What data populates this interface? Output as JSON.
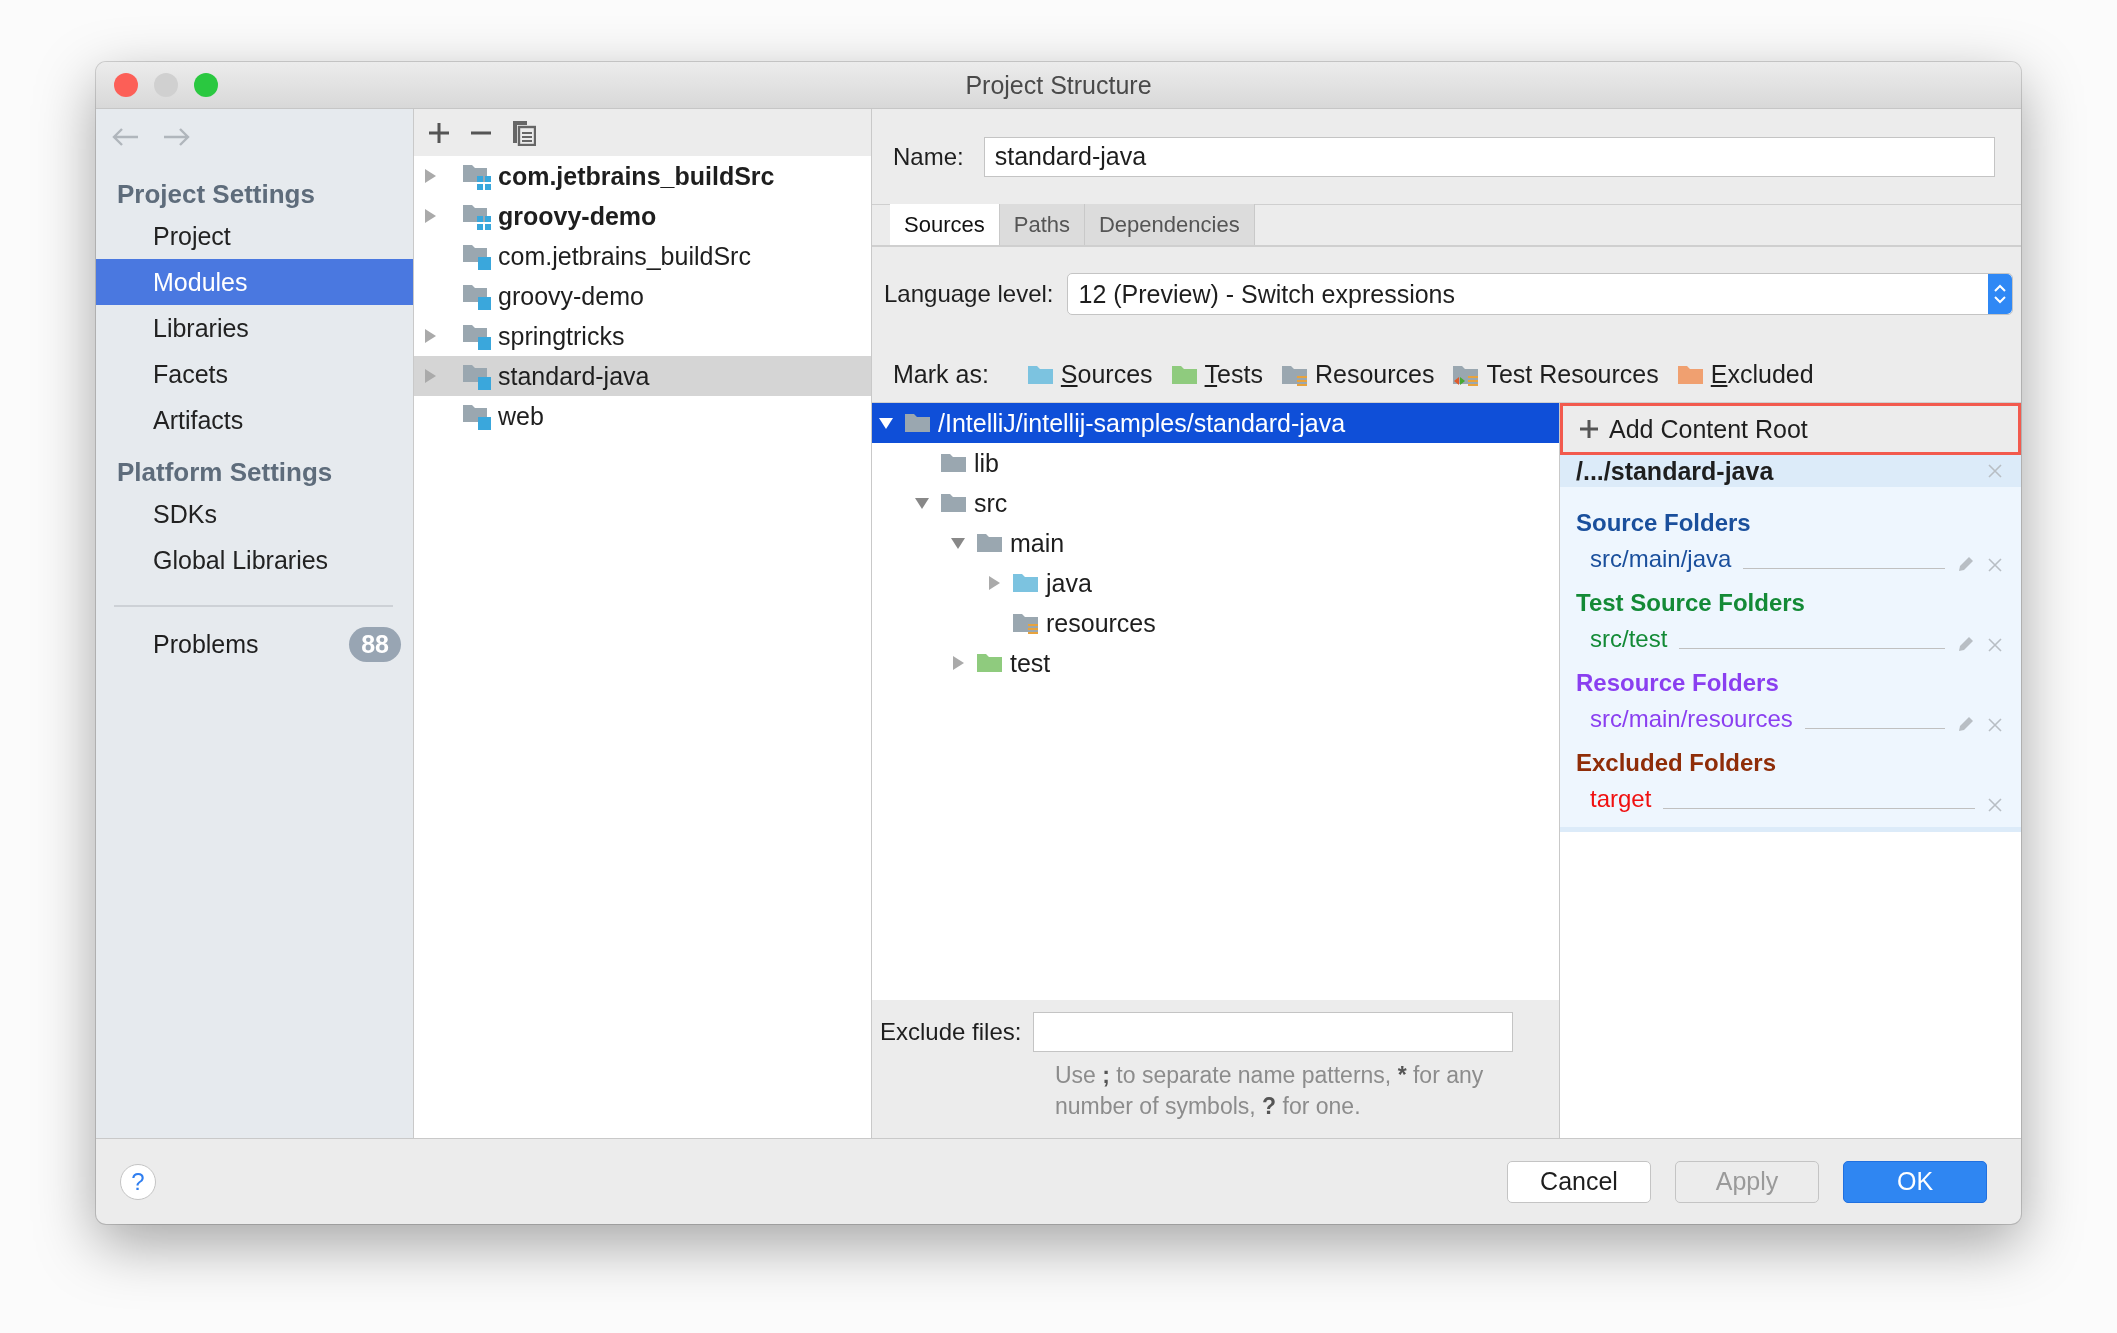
{
  "window": {
    "title": "Project Structure"
  },
  "sidebar": {
    "sections": [
      {
        "heading": "Project Settings",
        "items": [
          {
            "label": "Project",
            "selected": false
          },
          {
            "label": "Modules",
            "selected": true
          },
          {
            "label": "Libraries",
            "selected": false
          },
          {
            "label": "Facets",
            "selected": false
          },
          {
            "label": "Artifacts",
            "selected": false
          }
        ]
      },
      {
        "heading": "Platform Settings",
        "items": [
          {
            "label": "SDKs",
            "selected": false
          },
          {
            "label": "Global Libraries",
            "selected": false
          }
        ]
      }
    ],
    "problems": {
      "label": "Problems",
      "count": "88"
    }
  },
  "module_list": {
    "items": [
      {
        "label": "com.jetbrains_buildSrc",
        "kind": "group",
        "expanded": false,
        "selected": false
      },
      {
        "label": "groovy-demo",
        "kind": "group",
        "expanded": false,
        "selected": false
      },
      {
        "label": "com.jetbrains_buildSrc",
        "kind": "module",
        "selected": false
      },
      {
        "label": "groovy-demo",
        "kind": "module",
        "selected": false
      },
      {
        "label": "springtricks",
        "kind": "module",
        "expanded": false,
        "selected": false
      },
      {
        "label": "standard-java",
        "kind": "module",
        "expanded": false,
        "selected": true
      },
      {
        "label": "web",
        "kind": "module",
        "selected": false
      }
    ]
  },
  "name_field": {
    "label": "Name:",
    "value": "standard-java"
  },
  "tabs": [
    {
      "label": "Sources",
      "selected": true
    },
    {
      "label": "Paths",
      "selected": false
    },
    {
      "label": "Dependencies",
      "selected": false
    }
  ],
  "language_level": {
    "label": "Language level:",
    "value": "12 (Preview) - Switch expressions"
  },
  "mark_as": {
    "label": "Mark as:",
    "buttons": [
      {
        "label": "Sources",
        "kind": "sources",
        "mnemonic": true
      },
      {
        "label": "Tests",
        "kind": "tests",
        "mnemonic": true
      },
      {
        "label": "Resources",
        "kind": "resources",
        "mnemonic": false
      },
      {
        "label": "Test Resources",
        "kind": "test_resources",
        "mnemonic": false
      },
      {
        "label": "Excluded",
        "kind": "excluded",
        "mnemonic": true
      }
    ]
  },
  "content_tree": [
    {
      "label": "/IntelliJ/intellij-samples/standard-java",
      "kind": "plain",
      "expanded": true,
      "selected": true,
      "children": [
        {
          "label": "lib",
          "kind": "plain",
          "selected": false
        },
        {
          "label": "src",
          "kind": "plain",
          "expanded": true,
          "selected": false,
          "children": [
            {
              "label": "main",
              "kind": "plain",
              "expanded": true,
              "selected": false,
              "children": [
                {
                  "label": "java",
                  "kind": "sources",
                  "expanded": false,
                  "selected": false
                },
                {
                  "label": "resources",
                  "kind": "resources",
                  "selected": false
                }
              ]
            },
            {
              "label": "test",
              "kind": "tests",
              "expanded": false,
              "selected": false
            }
          ]
        }
      ]
    }
  ],
  "exclude_files": {
    "label": "Exclude files:",
    "hint": [
      {
        "text": "Use ",
        "bold": false
      },
      {
        "text": ";",
        "bold": true
      },
      {
        "text": " to separate name patterns, ",
        "bold": false
      },
      {
        "text": "*",
        "bold": true
      },
      {
        "text": " for any number of symbols, ",
        "bold": false
      },
      {
        "text": "?",
        "bold": true
      },
      {
        "text": " for one.",
        "bold": false
      }
    ]
  },
  "content_root": {
    "add_button": "Add Content Root",
    "root": "/.../standard-java",
    "groups": [
      {
        "title": "Source Folders",
        "color": "#1a4f9c",
        "folders": [
          {
            "path": "src/main/java",
            "color": "#1a4f9c",
            "editable": true
          }
        ]
      },
      {
        "title": "Test Source Folders",
        "color": "#138a36",
        "folders": [
          {
            "path": "src/test",
            "color": "#138a36",
            "editable": true
          }
        ]
      },
      {
        "title": "Resource Folders",
        "color": "#8a3ff0",
        "folders": [
          {
            "path": "src/main/resources",
            "color": "#8a3ff0",
            "editable": true
          }
        ]
      },
      {
        "title": "Excluded Folders",
        "color": "#8f2d08",
        "folders": [
          {
            "path": "target",
            "color": "#f01010",
            "editable": false
          }
        ]
      }
    ]
  },
  "footer": {
    "help": "?",
    "buttons": [
      {
        "label": "Cancel",
        "disabled": false,
        "default": false
      },
      {
        "label": "Apply",
        "disabled": true,
        "default": false
      },
      {
        "label": "OK",
        "disabled": false,
        "default": true
      }
    ]
  }
}
